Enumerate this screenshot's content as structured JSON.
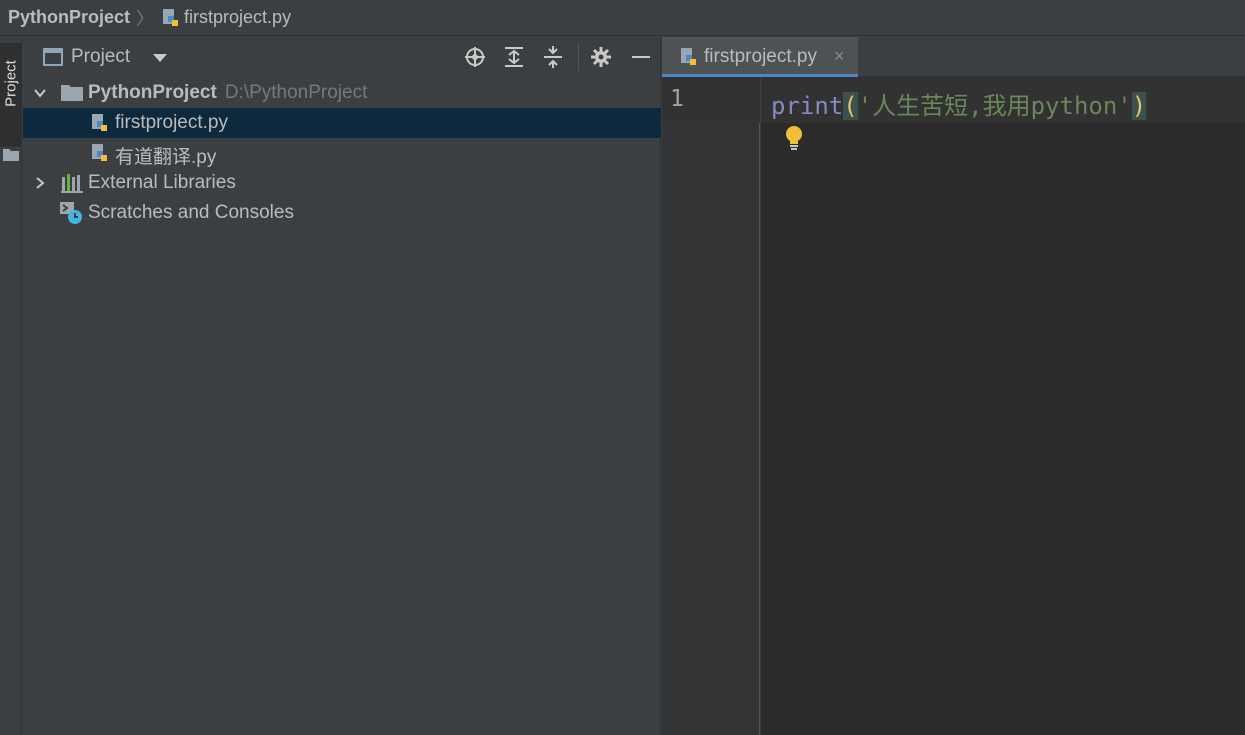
{
  "breadcrumb": {
    "project": "PythonProject",
    "file": "firstproject.py"
  },
  "tool_strip": {
    "project_tab": "Project"
  },
  "project_panel": {
    "title": "Project",
    "tree": {
      "root_name": "PythonProject",
      "root_path": "D:\\PythonProject",
      "files": [
        "firstproject.py",
        "有道翻译.py"
      ],
      "external_libraries": "External Libraries",
      "scratches": "Scratches and Consoles"
    }
  },
  "editor": {
    "tab_name": "firstproject.py",
    "tab_close": "×",
    "line_number": "1",
    "code": {
      "func": "print",
      "open_paren": "(",
      "string": "'人生苦短,我用python'",
      "close_paren": ")"
    }
  },
  "colors": {
    "selection": "#0d293e",
    "keyword": "#8888c6",
    "string": "#6a8759",
    "paren": "#e8bf6a",
    "bulb": "#f2c037"
  }
}
